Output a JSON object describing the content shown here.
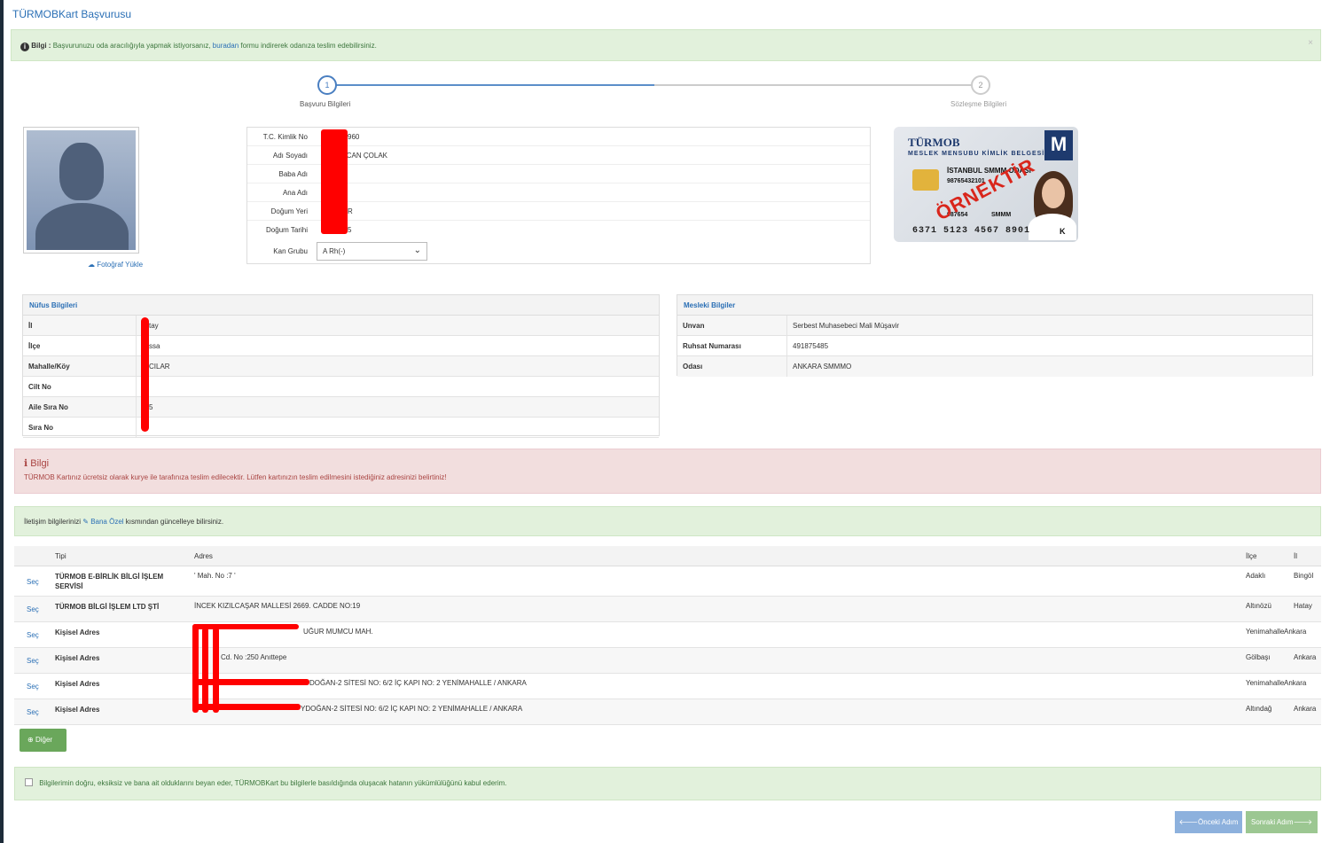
{
  "page": {
    "title": "TÜRMOBKart Başvurusu"
  },
  "info_alert": {
    "label": "Bilgi :",
    "text_before": "Başvurunuzu oda aracılığıyla yapmak istiyorsanız,",
    "link": "buradan",
    "text_after": "formu indirerek odanıza teslim edebilirsiniz.",
    "close": "×"
  },
  "steps": [
    {
      "number": "1",
      "label": "Başvuru Bilgileri"
    },
    {
      "number": "2",
      "label": "Sözleşme Bilgileri"
    }
  ],
  "photo": {
    "upload_label": "Fotoğraf Yükle"
  },
  "personal": {
    "fields": [
      {
        "label": "T.C. Kimlik No",
        "value": "960"
      },
      {
        "label": "Adı Soyadı",
        "value": "RCAN ÇOLAK"
      },
      {
        "label": "Baba Adı",
        "value": ""
      },
      {
        "label": "Ana Adı",
        "value": ""
      },
      {
        "label": "Doğum Yeri",
        "value": "R"
      },
      {
        "label": "Doğum Tarihi",
        "value": "5"
      }
    ],
    "blood_group": {
      "label": "Kan Grubu",
      "value": "A Rh(-)"
    }
  },
  "sample_card": {
    "brand": "TÜRMOB",
    "subtitle": "MESLEK MENSUBU KİMLİK BELGESİ",
    "logo": "M",
    "chamber": "İSTANBUL SMMM ODASI",
    "id_number": "98765432101",
    "license": "987654",
    "title": "SMMM",
    "stamp": "ÖRNEKTİR",
    "card_number": "6371 5123 4567 8901",
    "suffix": "K"
  },
  "nufus": {
    "title": "Nüfus Bilgileri",
    "rows": [
      {
        "key": "İl",
        "value": "tay"
      },
      {
        "key": "İlçe",
        "value": "ssa"
      },
      {
        "key": "Mahalle/Köy",
        "value": "CILAR"
      },
      {
        "key": "Cilt No",
        "value": ""
      },
      {
        "key": "Aile Sıra No",
        "value": "5"
      },
      {
        "key": "Sıra No",
        "value": ""
      }
    ]
  },
  "mesleki": {
    "title": "Mesleki Bilgiler",
    "rows": [
      {
        "key": "Unvan",
        "value": "Serbest Muhasebeci Mali Müşavir"
      },
      {
        "key": "Ruhsat Numarası",
        "value": "491875485"
      },
      {
        "key": "Odası",
        "value": "ANKARA SMMMO"
      }
    ]
  },
  "warning": {
    "icon": "ℹ",
    "title": "Bilgi",
    "text": "TÜRMOB Kartınız ücretsiz olarak kurye ile tarafınıza teslim edilecektir. Lütfen kartınızın teslim edilmesini istediğiniz adresinizi belirtiniz!"
  },
  "contact_note": {
    "before": "İletişim bilgilerinizi",
    "link": "Bana Özel",
    "after": "kısmından güncelleye bilirsiniz."
  },
  "address_table": {
    "headers": {
      "type": "Tipi",
      "address": "Adres",
      "district": "İlçe",
      "province": "İl"
    },
    "rows": [
      {
        "select": "Seç",
        "type": "TÜRMOB E-BİRLİK BİLGİ İŞLEM SERVİSİ",
        "address": "' Mah. No :7 '",
        "district": "Adaklı",
        "province": "Bingöl"
      },
      {
        "select": "Seç",
        "type": "TÜRMOB BİLGİ İŞLEM LTD ŞTİ",
        "address": "İNCEK KIZILCAŞAR MALLESİ 2669. CADDE NO:19",
        "district": "Altınözü",
        "province": "Hatay"
      },
      {
        "select": "Seç",
        "type": "Kişisel Adres",
        "address": "UĞUR MUMCU MAH.",
        "district": "Yenimahalle",
        "province": "Ankara"
      },
      {
        "select": "Seç",
        "type": "Kişisel Adres",
        "address": "Cd. No :250 Anıttepe",
        "district": "Gölbaşı",
        "province": "Ankara"
      },
      {
        "select": "Seç",
        "type": "Kişisel Adres",
        "address": "DOĞAN-2 SİTESİ NO: 6/2 İÇ KAPI NO: 2 YENİMAHALLE / ANKARA",
        "district": "Yenimahalle",
        "province": "Ankara"
      },
      {
        "select": "Seç",
        "type": "Kişisel Adres",
        "address": "YDOĞAN-2 SİTESİ NO: 6/2 İÇ KAPI NO: 2 YENİMAHALLE / ANKARA",
        "district": "Altındağ",
        "province": "Ankara"
      }
    ]
  },
  "other_button": {
    "label": "Diğer"
  },
  "declaration": {
    "text": "Bilgilerimin doğru, eksiksiz ve bana ait olduklarını beyan eder, TÜRMOBKart bu bilgilerle basıldığında oluşacak hatanın yükümlülüğünü kabul ederim."
  },
  "nav": {
    "prev": "🡐Önceki Adım",
    "next": "Sonraki Adım🡒"
  },
  "colors": {
    "accent": "#2a6fb5",
    "success_bg": "#e2f1dc",
    "danger_bg": "#f2dede",
    "redaction": "#ff0000"
  }
}
